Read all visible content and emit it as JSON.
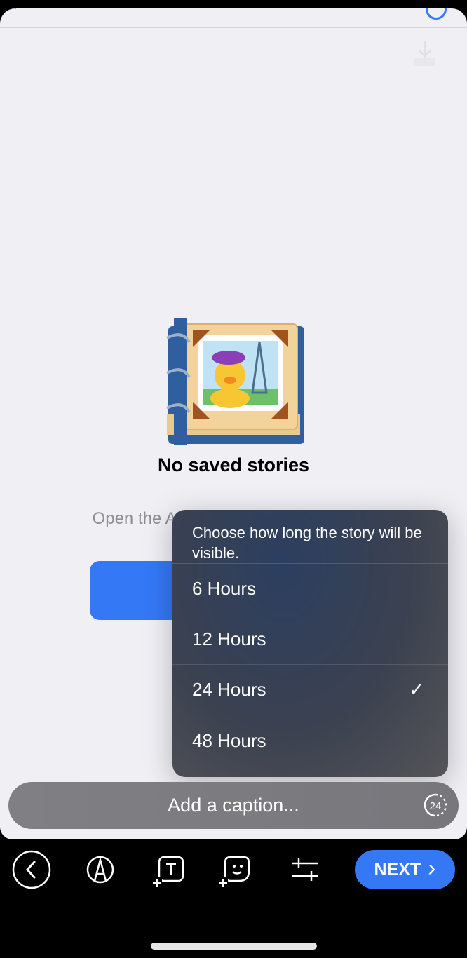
{
  "empty_state": {
    "title": "No saved stories",
    "description": "Open the Archive to select stories you want to be"
  },
  "visibility_menu": {
    "header": "Choose how long the story will be visible.",
    "options": [
      {
        "label": "6 Hours",
        "selected": false
      },
      {
        "label": "12 Hours",
        "selected": false
      },
      {
        "label": "24 Hours",
        "selected": true
      },
      {
        "label": "48 Hours",
        "selected": false
      }
    ],
    "check_glyph": "✓"
  },
  "caption": {
    "placeholder": "Add a caption...",
    "timer_value": "24"
  },
  "toolbar": {
    "next_label": "NEXT",
    "next_glyph": "›"
  },
  "colors": {
    "accent": "#3478f6",
    "background": "#efeff4"
  }
}
